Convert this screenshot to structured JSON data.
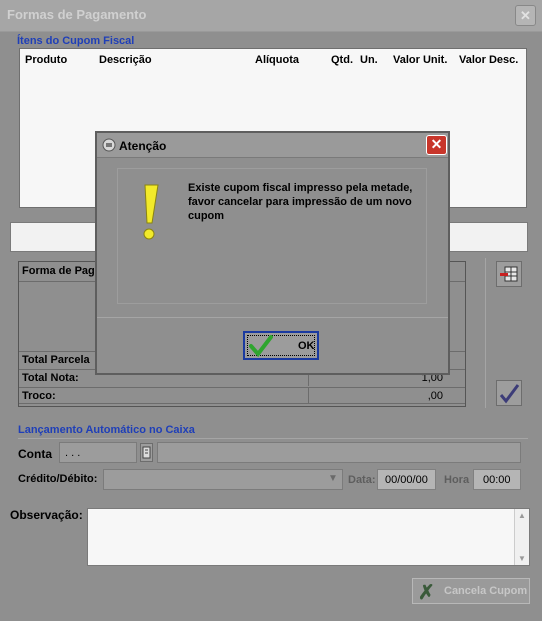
{
  "window": {
    "title": "Formas de Pagamento",
    "close_glyph": "✕"
  },
  "cupom": {
    "group_label": "Ítens do Cupom Fiscal",
    "columns": [
      "Produto",
      "Descrição",
      "Alíquota",
      "Qtd.",
      "Un.",
      "Valor Unit.",
      "Valor Desc."
    ]
  },
  "pagamento": {
    "col_forma": "Forma de Pag",
    "total_parcelas_label": "Total Parcela",
    "total_nota_label": "Total Nota:",
    "total_nota_value": "1,00",
    "troco_label": "Troco:",
    "troco_value": ",00"
  },
  "lancamento": {
    "group_label": "Lançamento Automático no Caixa",
    "conta_label": "Conta",
    "conta_value": ". . .",
    "credito_label": "Crédito/Débito:",
    "data_label": "Data:",
    "data_value": "00/00/00",
    "hora_label": "Hora",
    "hora_value": "00:00"
  },
  "observacao": {
    "label": "Observação:"
  },
  "cancel_button": {
    "label": "Cancela Cupom"
  },
  "dialog": {
    "title": "Atenção",
    "message": "Existe cupom fiscal impresso pela metade, favor cancelar para impressão de um novo cupom",
    "ok_label": "OK",
    "close_glyph": "✕"
  },
  "colors": {
    "accent_blue": "#1f3fb8",
    "warning_yellow": "#f2ea2a",
    "ok_green": "#2fa52f",
    "close_red": "#c8362b"
  }
}
